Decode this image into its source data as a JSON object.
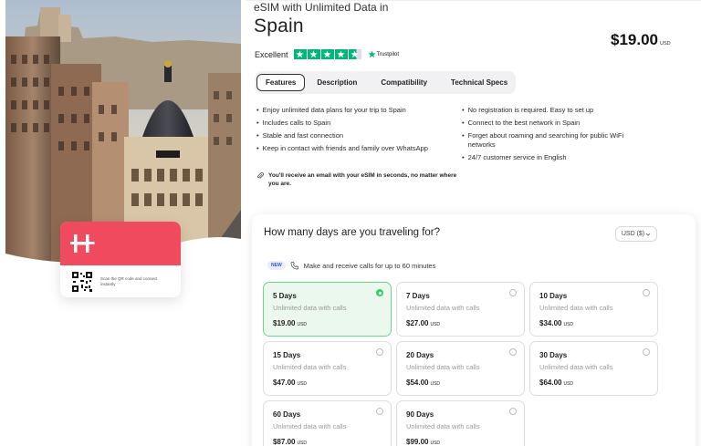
{
  "product": {
    "pre_title": "eSIM with Unlimited Data in",
    "title": "Spain",
    "price": "$19.00",
    "price_currency": "USD"
  },
  "rating": {
    "label": "Excellent",
    "stars": 4.5,
    "provider": "Trustpilot",
    "color": "#00b67a"
  },
  "card": {
    "hint": "Scan the QR code and connect instantly",
    "brand_color": "#ef4a5d"
  },
  "tabs": [
    {
      "label": "Features",
      "active": true
    },
    {
      "label": "Description",
      "active": false
    },
    {
      "label": "Compatibility",
      "active": false
    },
    {
      "label": "Technical Specs",
      "active": false
    }
  ],
  "features_left": [
    "Enjoy unlimited data plans for your trip to Spain",
    "Includes calls to Spain",
    "Stable and fast connection",
    "Keep in contact with friends and family over WhatsApp"
  ],
  "features_right": [
    "No registration is required. Easy to set up",
    "Connect to the best network in Spain",
    "Forget about roaming and searching for public WiFi networks",
    "24/7 customer service in English"
  ],
  "email_note": "You'll receive an email with your eSIM in seconds, no matter where you are.",
  "plan_panel": {
    "title": "How many days are you traveling for?",
    "currency_selector": "USD ($)",
    "promo_badge": "NEW",
    "promo_text": "Make and receive calls for up to 60 minutes",
    "accent_color": "#3ccc6b"
  },
  "plans": [
    {
      "days": "5 Days",
      "subtitle": "Unlimited data with calls",
      "price": "$19.00",
      "currency": "USD",
      "selected": true
    },
    {
      "days": "7 Days",
      "subtitle": "Unlimited data with calls",
      "price": "$27.00",
      "currency": "USD",
      "selected": false
    },
    {
      "days": "10 Days",
      "subtitle": "Unlimited data with calls",
      "price": "$34.00",
      "currency": "USD",
      "selected": false
    },
    {
      "days": "15 Days",
      "subtitle": "Unlimited data with calls",
      "price": "$47.00",
      "currency": "USD",
      "selected": false
    },
    {
      "days": "20 Days",
      "subtitle": "Unlimited data with calls",
      "price": "$54.00",
      "currency": "USD",
      "selected": false
    },
    {
      "days": "30 Days",
      "subtitle": "Unlimited data with calls",
      "price": "$64.00",
      "currency": "USD",
      "selected": false
    },
    {
      "days": "60 Days",
      "subtitle": "Unlimited data with calls",
      "price": "$87.00",
      "currency": "USD",
      "selected": false
    },
    {
      "days": "90 Days",
      "subtitle": "Unlimited data with calls",
      "price": "$99.00",
      "currency": "USD",
      "selected": false
    }
  ]
}
